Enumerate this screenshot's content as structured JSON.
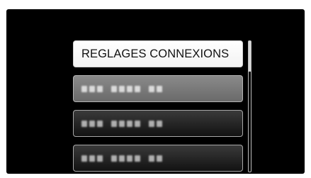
{
  "menu": {
    "items": [
      {
        "label": "REGLAGES CONNEXIONS",
        "state": "selected"
      },
      {
        "label": "",
        "state": "highlighted",
        "text_obscured": true
      },
      {
        "label": "",
        "state": "normal",
        "text_obscured": true
      },
      {
        "label": "",
        "state": "normal",
        "text_obscured": true
      }
    ]
  },
  "scrollbar": {
    "position": 0
  },
  "colors": {
    "screen_background": "#000000",
    "selected_item": "#ffffff",
    "highlighted_item": "#7a7a7a",
    "normal_item": "#262626"
  }
}
